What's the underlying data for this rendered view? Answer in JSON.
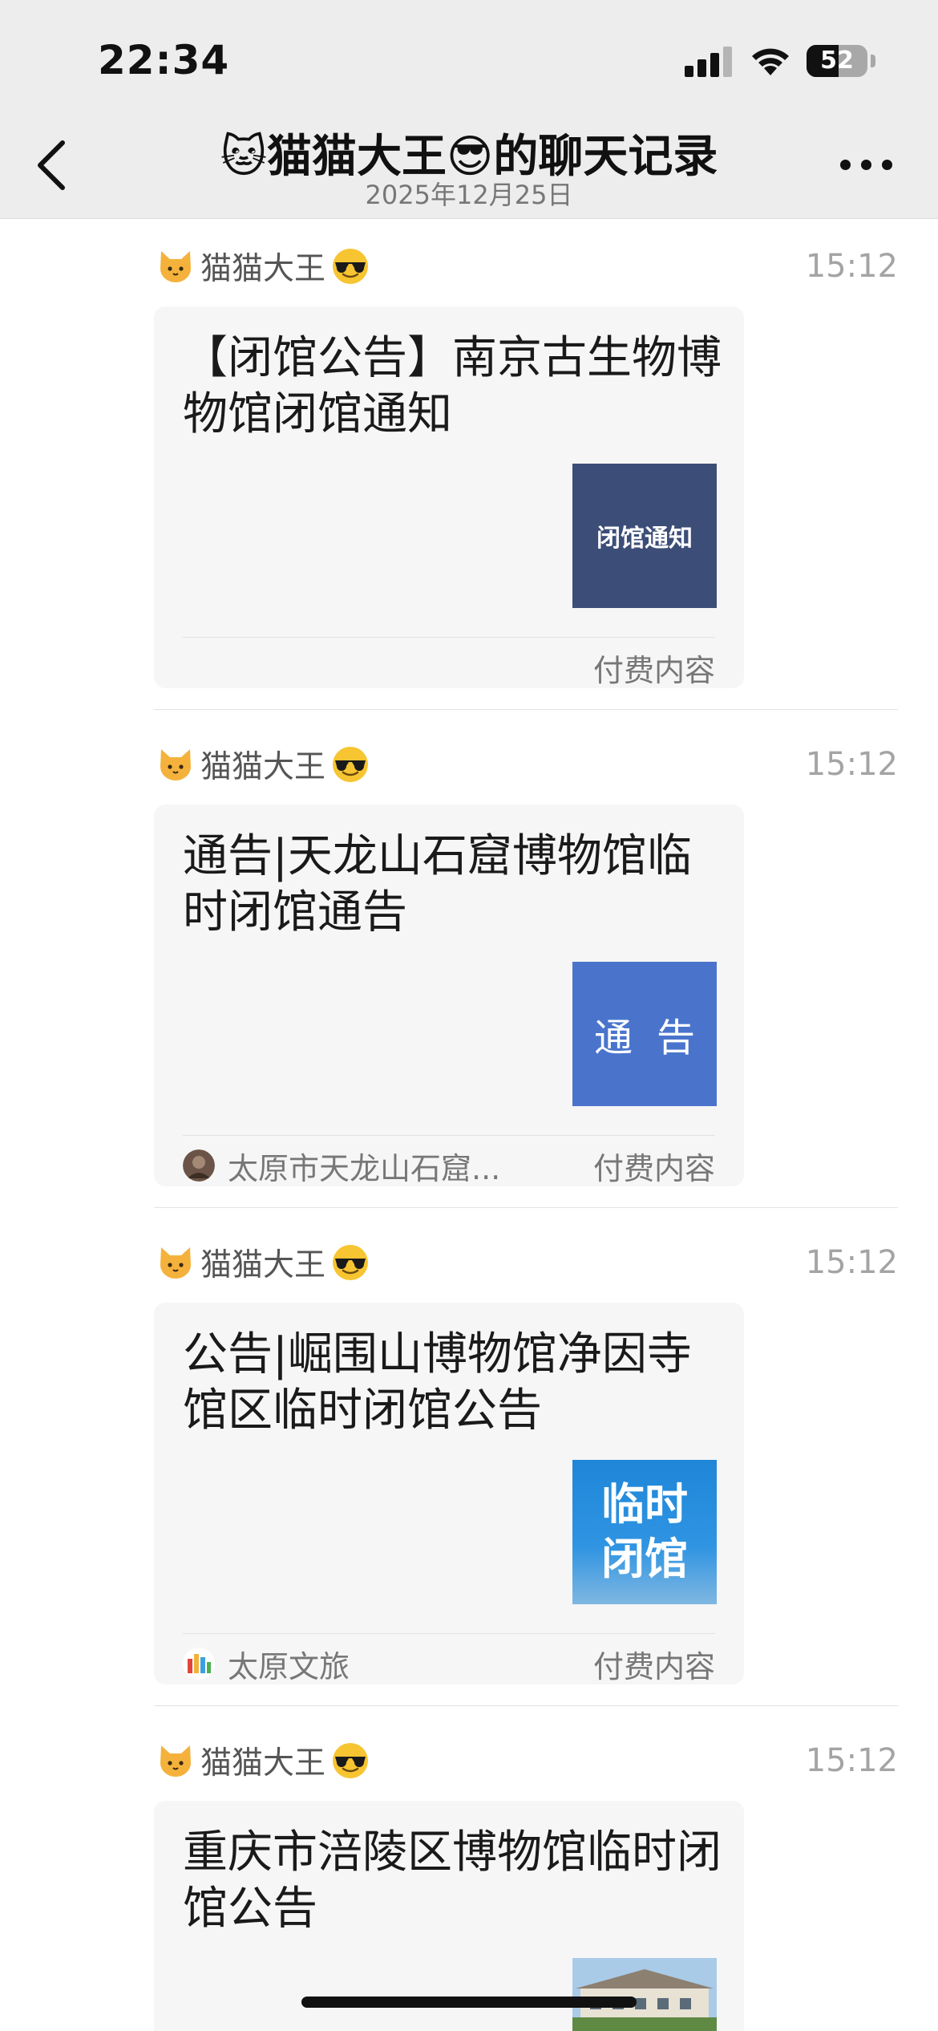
{
  "status_bar": {
    "time": "22:34",
    "battery": "52",
    "battery_level": 0.52
  },
  "nav": {
    "title": "🐱猫猫大王😎的聊天记录",
    "subtitle": "2025年12月25日"
  },
  "messages": [
    {
      "sender": "猫猫大王",
      "time": "15:12",
      "title": "【闭馆公告】南京古生物博物馆闭馆通知",
      "thumb_text": "闭馆通知",
      "source": "",
      "paid_label": "付费内容"
    },
    {
      "sender": "猫猫大王",
      "time": "15:12",
      "title": "通告|天龙山石窟博物馆临时闭馆通告",
      "thumb_text_1": "通",
      "thumb_text_2": "告",
      "source": "太原市天龙山石窟...",
      "paid_label": "付费内容"
    },
    {
      "sender": "猫猫大王",
      "time": "15:12",
      "title": "公告|崛围山博物馆净因寺馆区临时闭馆公告",
      "thumb_text_1": "临时",
      "thumb_text_2": "闭馆",
      "source": "太原文旅",
      "paid_label": "付费内容"
    },
    {
      "sender": "猫猫大王",
      "time": "15:12",
      "title": "重庆市涪陵区博物馆临时闭馆公告"
    }
  ],
  "colors": {
    "topbar_bg": "#ededed",
    "card_bg": "#f6f6f6",
    "thumb_navy": "#3c4d78",
    "thumb_blue": "#4a74cc",
    "thumb_sky": "#1f86d8"
  }
}
